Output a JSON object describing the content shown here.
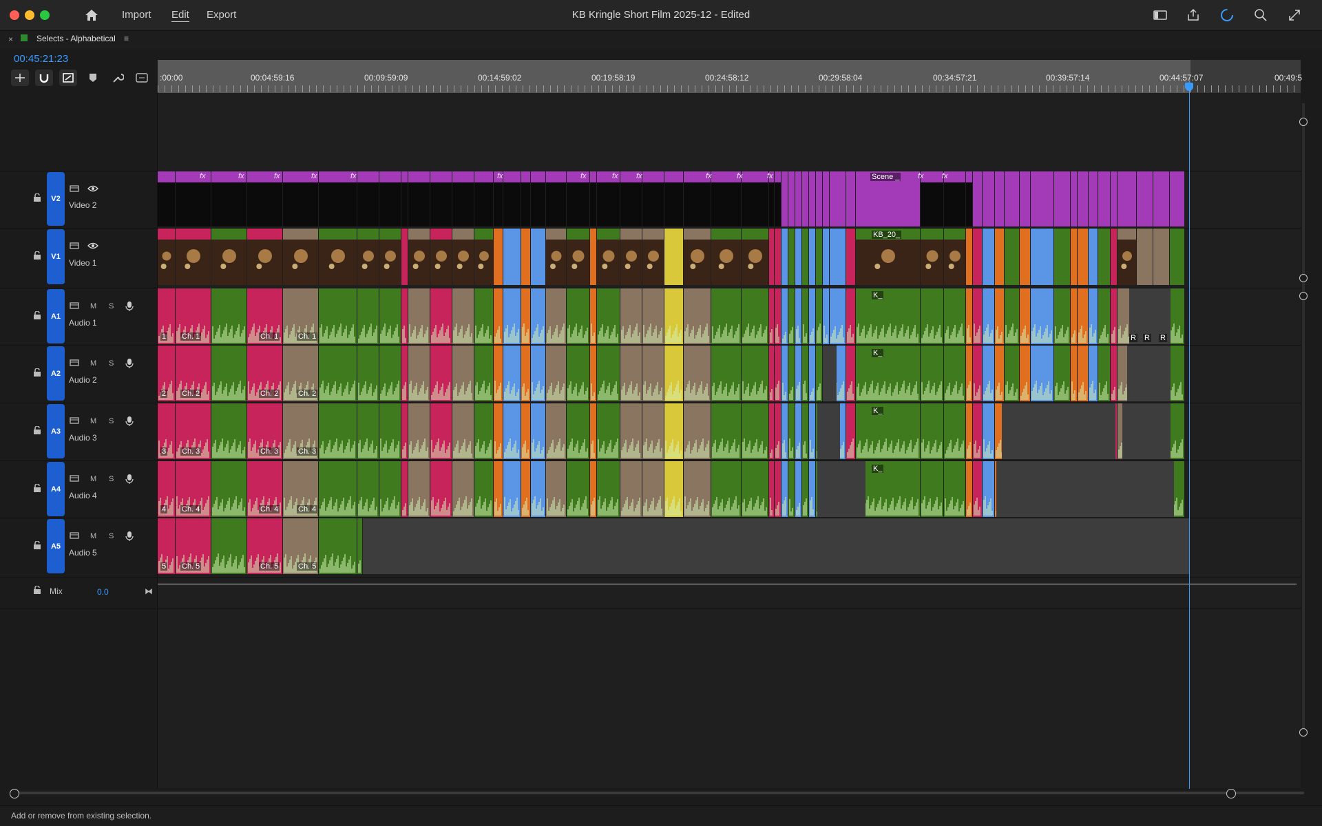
{
  "window": {
    "title": "KB Kringle Short Film 2025-12 - Edited",
    "menu": [
      "Import",
      "Edit",
      "Export"
    ],
    "active_menu": "Edit"
  },
  "panel": {
    "sequence_name": "Selects - Alphabetical",
    "timecode": "00:45:21:23"
  },
  "ruler": {
    "labels": [
      ":00:00",
      "00:04:59:16",
      "00:09:59:09",
      "00:14:59:02",
      "00:19:58:19",
      "00:24:58:12",
      "00:29:58:04",
      "00:34:57:21",
      "00:39:57:14",
      "00:44:57:07",
      "00:49:5"
    ]
  },
  "tracks": [
    {
      "id": "V2",
      "name": "Video 2",
      "kind": "video"
    },
    {
      "id": "V1",
      "name": "Video 1",
      "kind": "video"
    },
    {
      "id": "A1",
      "name": "Audio 1",
      "kind": "audio",
      "ch": "Ch. 1",
      "num": "1"
    },
    {
      "id": "A2",
      "name": "Audio 2",
      "kind": "audio",
      "ch": "Ch. 2",
      "num": "2"
    },
    {
      "id": "A3",
      "name": "Audio 3",
      "kind": "audio",
      "ch": "Ch. 3",
      "num": "3"
    },
    {
      "id": "A4",
      "name": "Audio 4",
      "kind": "audio",
      "ch": "Ch. 4",
      "num": "4"
    },
    {
      "id": "A5",
      "name": "Audio 5",
      "kind": "audio",
      "ch": "Ch. 5",
      "num": "5"
    }
  ],
  "audio_controls": {
    "mute": "M",
    "solo": "S"
  },
  "mix": {
    "label": "Mix",
    "value": "0.0"
  },
  "clip_labels": {
    "fx": "fx",
    "scene": "Scene _",
    "kb": "KB_20_",
    "k": "K_",
    "r": "R"
  },
  "status_bar": {
    "text": "Add or remove from existing selection."
  },
  "colors": {
    "accent": "#3a9bff",
    "track_badge": "#1d5fd1",
    "clip_magenta": "#a33bb8",
    "clip_pink": "#c8245c",
    "clip_green": "#3f7a1f",
    "clip_tan": "#8a7560",
    "clip_blue": "#5b95e6",
    "clip_orange": "#e07020",
    "clip_yellow": "#d9c83a",
    "waveform": "#d8f5b8"
  }
}
